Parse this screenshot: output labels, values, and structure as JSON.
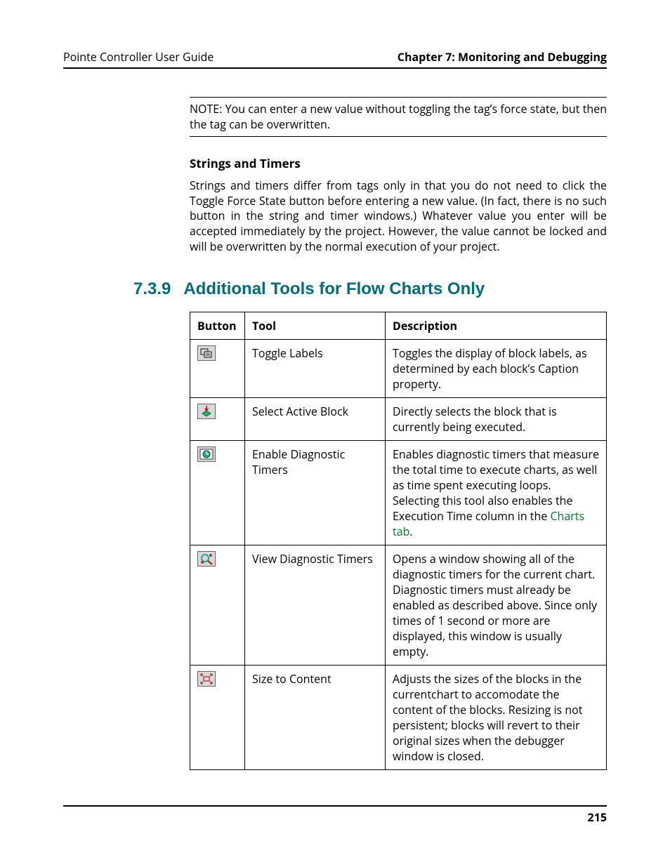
{
  "header": {
    "left": "Pointe Controller User Guide",
    "right": "Chapter 7: Monitoring and Debugging"
  },
  "note": "NOTE: You can enter a new value without toggling the tag’s force state, but then the tag can be overwritten.",
  "sub1": {
    "title": "Strings and Timers",
    "text": "Strings and timers differ from tags only in that you do not need to click the Toggle Force State button before entering a new value. (In fact, there is no such button in the string and timer windows.) Whatever value you enter will be accepted immediately by the project. However, the value cannot be locked and will be overwritten by the normal execution of your project."
  },
  "section": {
    "number": "7.3.9",
    "title": "Additional Tools for Flow Charts Only"
  },
  "table": {
    "headers": {
      "c1": "Button",
      "c2": "Tool",
      "c3": "Description"
    },
    "rows": [
      {
        "tool": "Toggle Labels",
        "desc": "Toggles the display of block labels, as determined by each block’s Caption property."
      },
      {
        "tool": "Select Active Block",
        "desc": "Directly selects the block that is currently being executed."
      },
      {
        "tool": "Enable Diagnostic Timers",
        "desc_pre": "Enables diagnostic timers that measure the total time to execute charts, as well as time spent executing loops. Selecting this tool also enables the Execution Time column in the ",
        "desc_link": "Charts tab",
        "desc_post": "."
      },
      {
        "tool": "View Diagnostic Timers",
        "desc": "Opens a window showing all of the diagnostic timers for the current chart. Diagnostic timers must already be enabled as described above. Since only times of 1 second or more are displayed, this window is usually empty."
      },
      {
        "tool": "Size to Content",
        "desc": "Adjusts the sizes of the blocks in the currentchart to accomodate the content of the blocks. Resizing is not persistent; blocks will revert to their original sizes when the debugger window is closed."
      }
    ]
  },
  "page_number": "215"
}
